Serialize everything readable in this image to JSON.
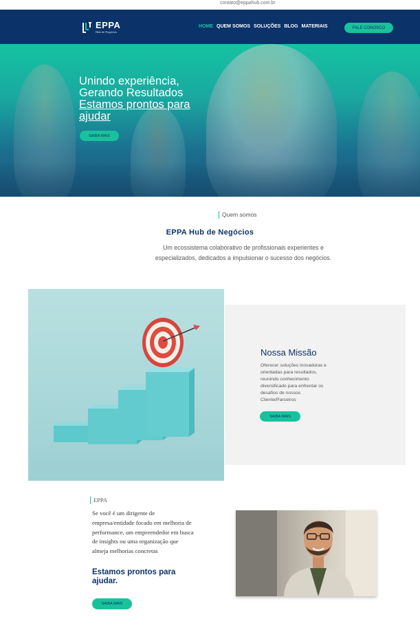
{
  "topbar": {
    "email": "contato@eppahub.com.br"
  },
  "header": {
    "logo_name": "EPPA",
    "logo_sub": "Hub de Negócios",
    "nav": [
      {
        "label": "HOME",
        "active": true
      },
      {
        "label": "QUEM SOMOS",
        "active": false
      },
      {
        "label": "SOLUÇÕES",
        "active": false
      },
      {
        "label": "BLOG",
        "active": false
      },
      {
        "label": "MATERIAIS",
        "active": false
      }
    ],
    "cta_label": "FALE CONOSCO"
  },
  "hero": {
    "line1": "Unindo experiência,",
    "line2": "Gerando Resultados",
    "line3": "Estamos prontos para",
    "line4": "ajudar",
    "button_label": "SAIBA MAIS"
  },
  "about": {
    "tag": "Quem somos",
    "title": "EPPA Hub de Negócios",
    "text": "Um ecossistema colaborativo de profissionais experientes e especializados, dedicados a impulsionar o sucesso dos negócios."
  },
  "mission": {
    "title": "Nossa Missão",
    "text": "Oferecer soluções inovadoras e orientadas para resultados, reunindo conhecimento diversificado para enfrentar os desafios de nossos Cliente/Parceiros",
    "button_label": "SAIBA MAIS"
  },
  "eppa": {
    "tag": "EPPA",
    "text": "Se você é um dirigente de empresa/entidade focado em melhoria de performance, um empreendedor em busca de insights ou uma organização que almeja melhorias concretas",
    "strong": "Estamos prontos para ajudar.",
    "button_label": "SAIBA MAIS"
  },
  "colors": {
    "navy": "#0b3269",
    "accent": "#18c29c",
    "panel": "#f2f2f2"
  }
}
